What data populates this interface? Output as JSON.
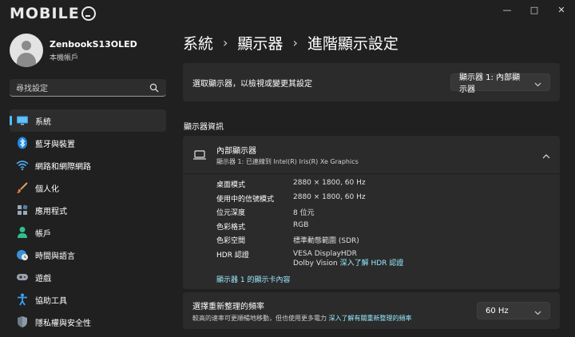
{
  "app": {
    "logo_text": "MOBILE",
    "window_controls": [
      "—",
      "□",
      "✕"
    ]
  },
  "profile": {
    "name": "ZenbookS13OLED",
    "account_type": "本機帳戶"
  },
  "search": {
    "placeholder": "尋找設定"
  },
  "sidebar": {
    "items": [
      {
        "label": "系統",
        "icon": "monitor-icon",
        "active": true
      },
      {
        "label": "藍牙與裝置",
        "icon": "bluetooth-icon"
      },
      {
        "label": "網路和網際網路",
        "icon": "wifi-icon"
      },
      {
        "label": "個人化",
        "icon": "brush-icon"
      },
      {
        "label": "應用程式",
        "icon": "apps-icon"
      },
      {
        "label": "帳戶",
        "icon": "person-icon"
      },
      {
        "label": "時間與語言",
        "icon": "globe-clock-icon"
      },
      {
        "label": "遊戲",
        "icon": "gamepad-icon"
      },
      {
        "label": "協助工具",
        "icon": "accessibility-icon"
      },
      {
        "label": "隱私權與安全性",
        "icon": "shield-icon"
      }
    ]
  },
  "breadcrumb": [
    "系統",
    "顯示器",
    "進階顯示設定"
  ],
  "select_display": {
    "label": "選取顯示器，以檢視或變更其設定",
    "value": "顯示器 1: 內部顯示器"
  },
  "section_title": "顯示器資訊",
  "display_info": {
    "title": "內部顯示器",
    "subtitle": "顯示器 1: 已連線到 Intel(R) Iris(R) Xe Graphics",
    "rows": [
      {
        "key": "桌面模式",
        "value": "2880 × 1800, 60 Hz"
      },
      {
        "key": "使用中的信號模式",
        "value": "2880 × 1800, 60 Hz"
      },
      {
        "key": "位元深度",
        "value": "8 位元"
      },
      {
        "key": "色彩格式",
        "value": "RGB"
      },
      {
        "key": "色彩空間",
        "value": "標準動態範圍 (SDR)"
      }
    ],
    "hdr": {
      "key": "HDR 認證",
      "line1": "VESA DisplayHDR",
      "line2_text": "Dolby Vision",
      "line2_link": "深入了解 HDR 認證"
    },
    "adapter_link": "顯示器 1 的顯示卡內容"
  },
  "refresh_rate": {
    "title": "選擇重新整理的頻率",
    "description": "較高的速率可更順暢地移動，但也使用更多電力",
    "link": "深入了解有關重新整理的頻率",
    "value": "60 Hz"
  },
  "colors": {
    "accent": "#4cc2ff",
    "link": "#99ebff",
    "background": "#202020",
    "card": "#2b2b2b"
  }
}
